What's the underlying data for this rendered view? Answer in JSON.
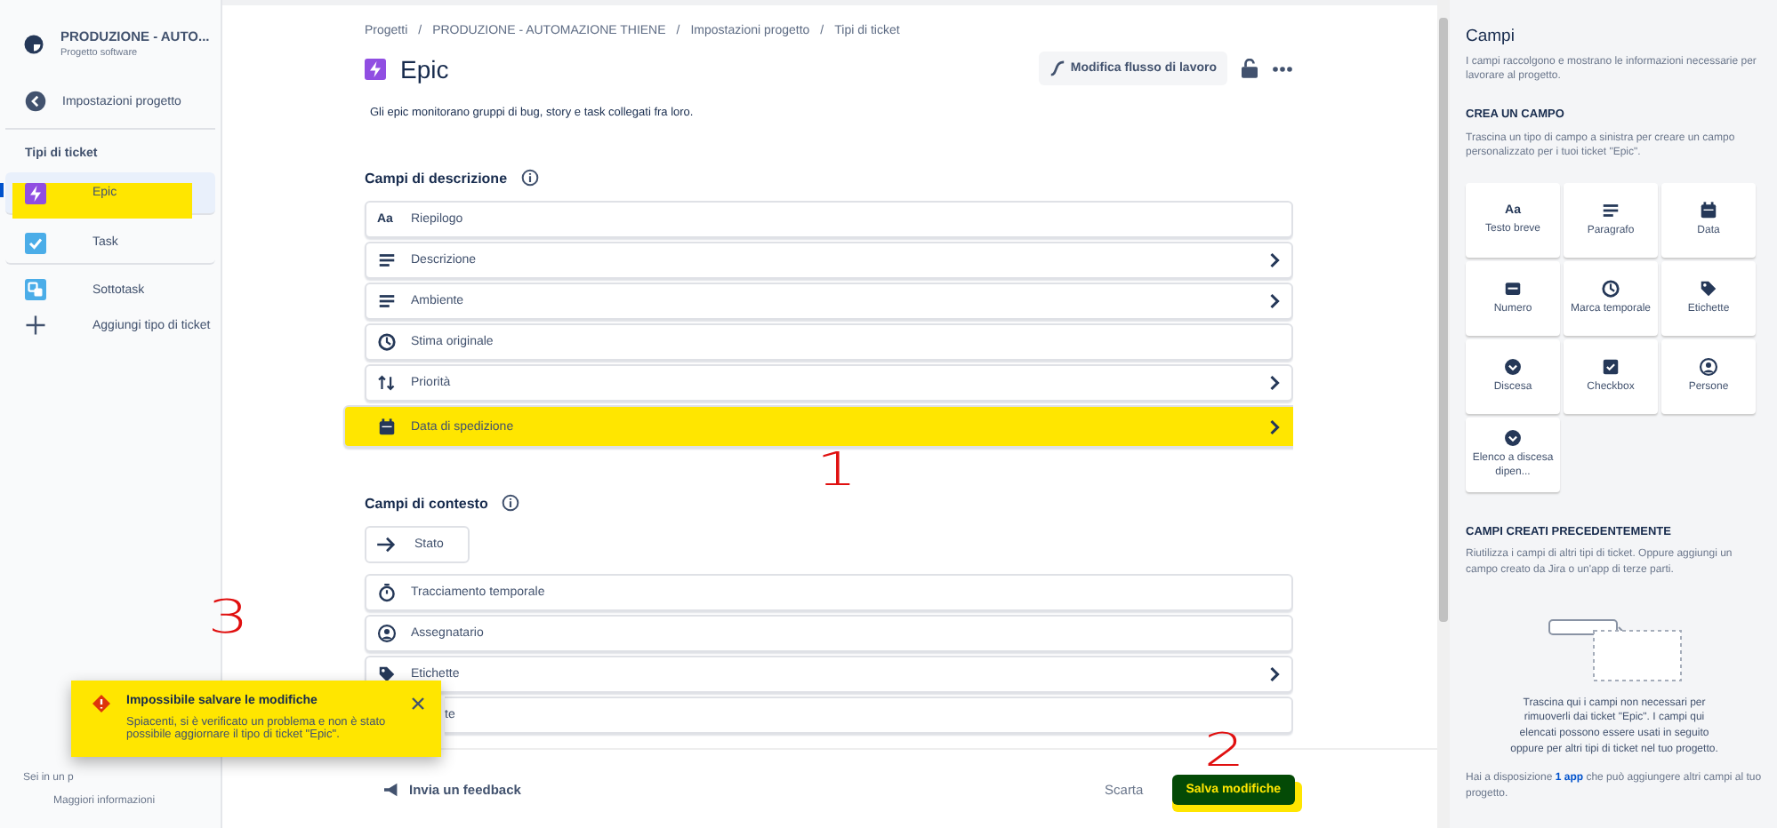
{
  "sidebar": {
    "project_name": "PRODUZIONE - AUTO...",
    "project_type": "Progetto software",
    "back_link": "Impostazioni progetto",
    "section_title": "Tipi di ticket",
    "items": [
      {
        "label": "Epic",
        "kind": "epic",
        "selected": true,
        "highlighted": true
      },
      {
        "label": "Task",
        "kind": "task",
        "selected": false,
        "highlighted": false
      },
      {
        "label": "Sottotask",
        "kind": "subtask",
        "selected": false,
        "highlighted": false
      },
      {
        "label": "Aggiungi tipo di ticket",
        "kind": "add",
        "selected": false,
        "highlighted": false
      }
    ],
    "footer_text": "Sei in un p",
    "footer_link": "Maggiori informazioni"
  },
  "breadcrumbs": [
    "Progetti",
    "/",
    "PRODUZIONE - AUTOMAZIONE THIENE",
    "/",
    "Impostazioni progetto",
    "/",
    "Tipi di ticket"
  ],
  "header": {
    "title": "Epic",
    "workflow_button": "Modifica flusso di lavoro",
    "description": "Gli epic monitorano gruppi di bug, story e task collegati fra loro."
  },
  "description_fields": {
    "title": "Campi di descrizione",
    "rows": [
      {
        "label": "Riepilogo",
        "kind": "text",
        "glyph": "Aa",
        "expandable": false,
        "highlighted": false
      },
      {
        "label": "Descrizione",
        "kind": "lines",
        "expandable": true,
        "highlighted": false
      },
      {
        "label": "Ambiente",
        "kind": "lines",
        "expandable": true,
        "highlighted": false
      },
      {
        "label": "Stima originale",
        "kind": "clock",
        "expandable": false,
        "highlighted": false
      },
      {
        "label": "Priorità",
        "kind": "priority",
        "expandable": true,
        "highlighted": false
      },
      {
        "label": "Data di spedizione",
        "kind": "calendar",
        "expandable": true,
        "highlighted": true
      }
    ]
  },
  "context_fields": {
    "title": "Campi di contesto",
    "status_chip": "Stato",
    "rows": [
      {
        "label": "Tracciamento temporale",
        "kind": "stopwatch",
        "expandable": false
      },
      {
        "label": "Assegnatario",
        "kind": "person",
        "expandable": false
      },
      {
        "label": "Etichette",
        "kind": "tag",
        "expandable": true
      },
      {
        "label": "te",
        "kind": "covered",
        "expandable": false
      }
    ]
  },
  "footer": {
    "feedback": "Invia un feedback",
    "discard": "Scarta",
    "save": "Salva modifiche",
    "save_highlighted": true
  },
  "toast": {
    "title": "Impossibile salvare le modifiche",
    "message": "Spiacenti, si è verificato un problema e non è stato possibile aggiornare il tipo di ticket \"Epic\".",
    "highlighted": true
  },
  "panel": {
    "title": "Campi",
    "description": "I campi raccolgono e mostrano le informazioni necessarie per lavorare al progetto.",
    "create_title": "CREA UN CAMPO",
    "create_description": "Trascina un tipo di campo a sinistra per creare un campo personalizzato per i tuoi ticket \"Epic\".",
    "field_types": [
      {
        "label": "Testo breve",
        "kind": "text",
        "glyph": "Aa"
      },
      {
        "label": "Paragrafo",
        "kind": "lines"
      },
      {
        "label": "Data",
        "kind": "calendar"
      },
      {
        "label": "Numero",
        "kind": "number"
      },
      {
        "label": "Marca temporale",
        "kind": "clock"
      },
      {
        "label": "Etichette",
        "kind": "tag"
      },
      {
        "label": "Discesa",
        "kind": "dropdown"
      },
      {
        "label": "Checkbox",
        "kind": "checkbox"
      },
      {
        "label": "Persone",
        "kind": "person"
      },
      {
        "label": "Elenco a discesa dipen...",
        "kind": "dropdown"
      }
    ],
    "previous_title": "CAMPI CREATI PRECEDENTEMENTE",
    "previous_description": "Riutilizza i campi di altri tipi di ticket. Oppure aggiungi un campo creato da Jira o un'app di terze parti.",
    "drop_text": "Trascina qui i campi non necessari per rimuoverli dai ticket \"Epic\". I campi qui elencati possono essere usati in seguito oppure per altri tipi di ticket nel tuo progetto.",
    "apps_text": "Hai a disposizione **1 app** che può aggiungere altri campi al tuo progetto."
  },
  "annotations": [
    "1",
    "2",
    "3"
  ]
}
